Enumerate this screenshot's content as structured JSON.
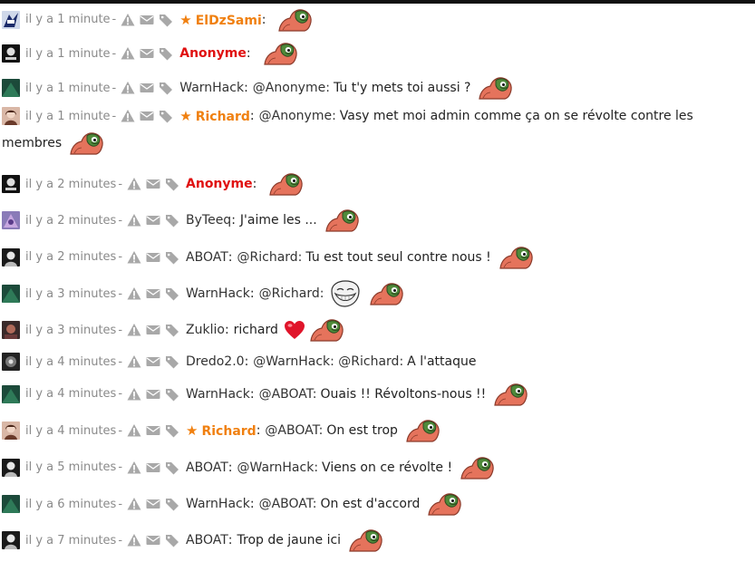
{
  "colors": {
    "moderator": "#f08010",
    "anonymous": "#e01010",
    "meta": "#8a8a8a",
    "icon": "#a8a8a8"
  },
  "icons": {
    "report": "warning-triangle-icon",
    "message": "envelope-icon",
    "tag": "tag-icon",
    "rank": "star-icon",
    "emote": "pepe-frog-emote",
    "troll": "trollface-emote",
    "heart": "heart-emoji"
  },
  "messages": [
    {
      "time": "il y a 1 minute",
      "user": "ElDzSami",
      "text": ""
    },
    {
      "time": "il y a 1 minute",
      "user": "Anonyme",
      "text": ""
    },
    {
      "time": "il y a 1 minute",
      "user": "WarnHack",
      "mention": "@Anonyme:",
      "text": "Tu t'y mets toi aussi ?"
    },
    {
      "time": "il y a 1 minute",
      "user": "Richard",
      "mention": "@Anonyme:",
      "text": "Vasy met moi admin comme ça on se révolte contre les",
      "text2": "membres"
    },
    {
      "time": "il y a 2 minutes",
      "user": "Anonyme",
      "text": ""
    },
    {
      "time": "il y a 2 minutes",
      "user": "ByTeeq",
      "text": "J'aime les ..."
    },
    {
      "time": "il y a 2 minutes",
      "user": "ABOAT",
      "mention": "@Richard:",
      "text": "Tu est tout seul contre nous !"
    },
    {
      "time": "il y a 3 minutes",
      "user": "WarnHack",
      "mention": "@Richard:",
      "text": ""
    },
    {
      "time": "il y a 3 minutes",
      "user": "Zuklio",
      "text": "richard"
    },
    {
      "time": "il y a 4 minutes",
      "user": "Dredo2.0",
      "mention": "@WarnHack: @Richard:",
      "text": "A l'attaque"
    },
    {
      "time": "il y a 4 minutes",
      "user": "WarnHack",
      "mention": "@ABOAT:",
      "text": "Ouais !! Révoltons-nous !!"
    },
    {
      "time": "il y a 4 minutes",
      "user": "Richard",
      "mention": "@ABOAT:",
      "text": "On est trop"
    },
    {
      "time": "il y a 5 minutes",
      "user": "ABOAT",
      "mention": "@WarnHack:",
      "text": "Viens on ce révolte !"
    },
    {
      "time": "il y a 6 minutes",
      "user": "WarnHack",
      "mention": "@ABOAT:",
      "text": "On est d'accord"
    },
    {
      "time": "il y a 7 minutes",
      "user": "ABOAT",
      "text": "Trop de jaune ici"
    }
  ]
}
